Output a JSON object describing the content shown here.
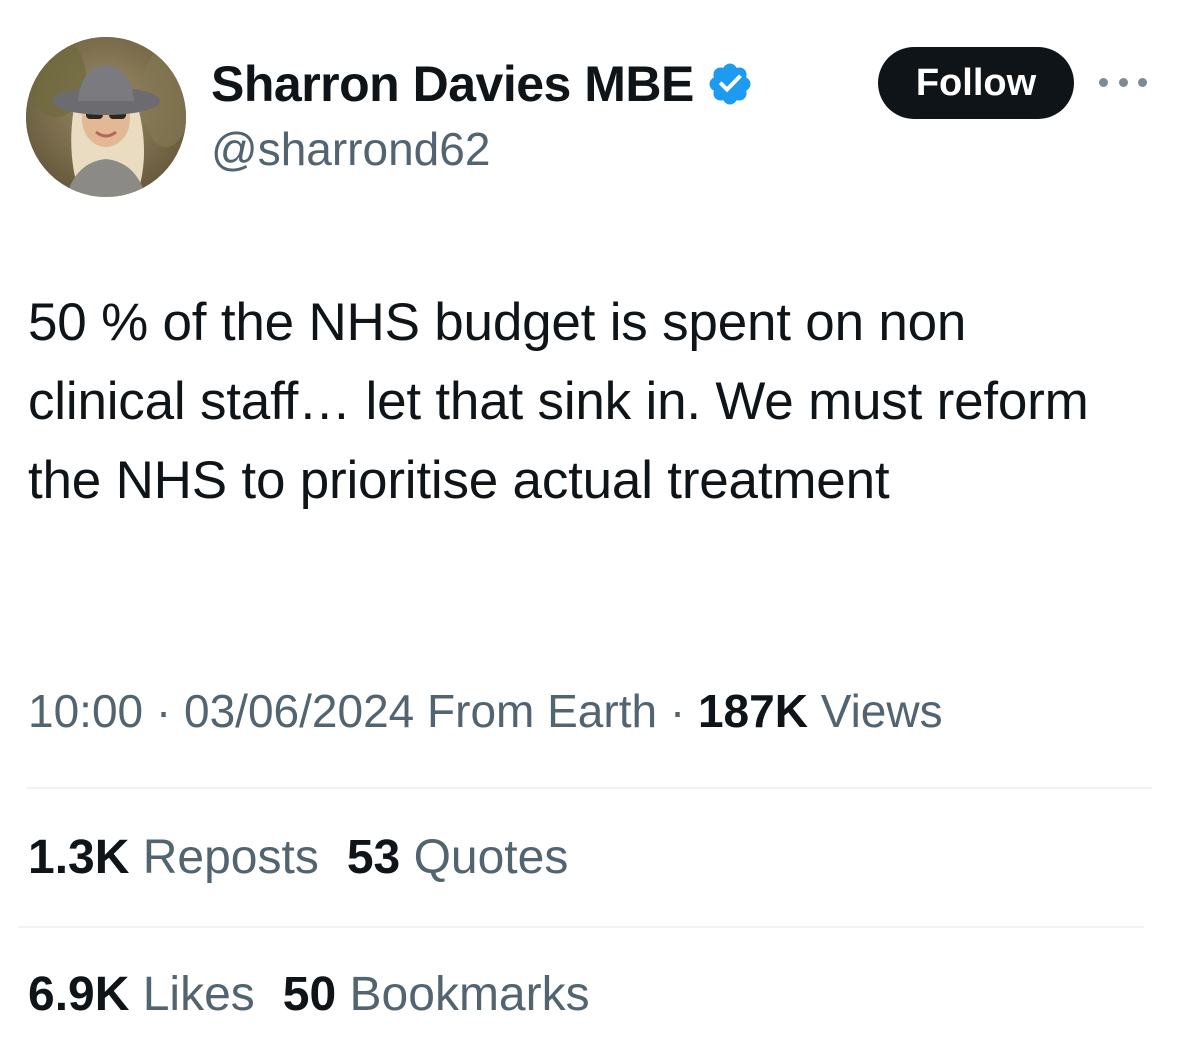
{
  "author": {
    "display_name": "Sharron Davies MBE",
    "handle": "@sharrond62",
    "verified_icon": "verified-badge-icon",
    "verified_color": "#1d9bf0"
  },
  "follow_label": "Follow",
  "tweet": {
    "text": "50 % of the NHS budget is spent on non clinical staff… let that sink in. We must reform the NHS to prioritise actual treatment"
  },
  "meta": {
    "time": "10:00",
    "separator": " · ",
    "date": "03/06/2024",
    "source": "From Earth",
    "views_count": "187K",
    "views_label": "Views"
  },
  "stats": {
    "reposts_count": "1.3K",
    "reposts_label": "Reposts",
    "quotes_count": "53",
    "quotes_label": "Quotes",
    "likes_count": "6.9K",
    "likes_label": "Likes",
    "bookmarks_count": "50",
    "bookmarks_label": "Bookmarks"
  },
  "colors": {
    "text": "#0f1419",
    "secondary": "#536471",
    "button_bg": "#0f1419",
    "divider": "#eff3f4"
  }
}
